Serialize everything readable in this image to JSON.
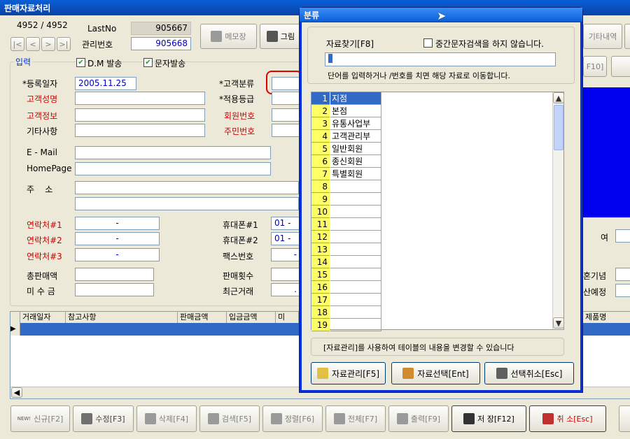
{
  "window": {
    "title": "판매자료처리"
  },
  "nav": {
    "record_pos": "4952 / 4952",
    "lastno_label": "LastNo",
    "lastno_value": "905667",
    "mgmt_label": "관리번호",
    "mgmt_value": "905668"
  },
  "toolbar_top": {
    "memo": "메모장",
    "picture": "그림",
    "history": "기타내역",
    "f10": "F10]"
  },
  "section": {
    "input_label": "입력",
    "dm_label": "D.M 발송",
    "sms_label": "문자발송"
  },
  "form": {
    "reg_date_label": "*등록일자",
    "reg_date_value": "2005.11.25",
    "cust_name_label": "고객성명",
    "cust_info_label": "고객정보",
    "etc_label": "기타사항",
    "cust_class_label": "*고객분류",
    "apply_grade_label": "*적용등급",
    "member_no_label": "회원번호",
    "resident_no_label": "주민번호",
    "email_label": "E - Mail",
    "homepage_label": "HomePage",
    "address_label": "주    소",
    "contact1_label": "연락처#1",
    "contact2_label": "연락처#2",
    "contact3_label": "연락처#3",
    "contact1_value": "-",
    "contact2_value": "-",
    "contact3_value": "-",
    "mobile1_label": "휴대폰#1",
    "mobile2_label": "휴대폰#2",
    "fax_label": "팩스번호",
    "mobile1_value": "01  -",
    "mobile2_value": "01  -",
    "fax_value": "-",
    "total_sales_label": "총판매액",
    "unpaid_label": "미 수 금",
    "sale_count_label": "판매횟수",
    "recent_trade_label": "최근거래",
    "recent_trade_value": ".",
    "right_label_1": "여",
    "right_label_2": "혼기념",
    "right_label_3": "산예정"
  },
  "table": {
    "headers": [
      "거래일자",
      "참고사항",
      "판매금액",
      "입금금액",
      "미",
      "제품명"
    ]
  },
  "bottom": {
    "new": "신규[F2]",
    "new_badge": "NEW!",
    "edit": "수정[F3]",
    "delete": "삭제[F4]",
    "search": "검색[F5]",
    "sort": "정렬[F6]",
    "all": "전체[F7]",
    "print": "출력[F9]",
    "save": "저 장[F12]",
    "cancel": "취 소[Esc]"
  },
  "dialog": {
    "title": "분류",
    "search_label": "자료찾기[F8]",
    "middle_search": "중간문자검색을 하지 않습니다.",
    "hint": "단어를 입력하거나  /번호를 치면 해당 자료로 이동합니다.",
    "rows": [
      {
        "no": "1",
        "name": "지점"
      },
      {
        "no": "2",
        "name": "본점"
      },
      {
        "no": "3",
        "name": "유통사업부"
      },
      {
        "no": "4",
        "name": "고객관리부"
      },
      {
        "no": "5",
        "name": "일반회원"
      },
      {
        "no": "6",
        "name": "종신회원"
      },
      {
        "no": "7",
        "name": "특별회원"
      },
      {
        "no": "8",
        "name": ""
      },
      {
        "no": "9",
        "name": ""
      },
      {
        "no": "10",
        "name": ""
      },
      {
        "no": "11",
        "name": ""
      },
      {
        "no": "12",
        "name": ""
      },
      {
        "no": "13",
        "name": ""
      },
      {
        "no": "14",
        "name": ""
      },
      {
        "no": "15",
        "name": ""
      },
      {
        "no": "16",
        "name": ""
      },
      {
        "no": "17",
        "name": ""
      },
      {
        "no": "18",
        "name": ""
      },
      {
        "no": "19",
        "name": ""
      }
    ],
    "footer_note": "[자료관리]를 사용하여 테이블의 내용을 변경할 수 있습니다",
    "btn_manage": "자료관리[F5]",
    "btn_select": "자료선택[Ent]",
    "btn_cancel": "선택취소[Esc]"
  }
}
